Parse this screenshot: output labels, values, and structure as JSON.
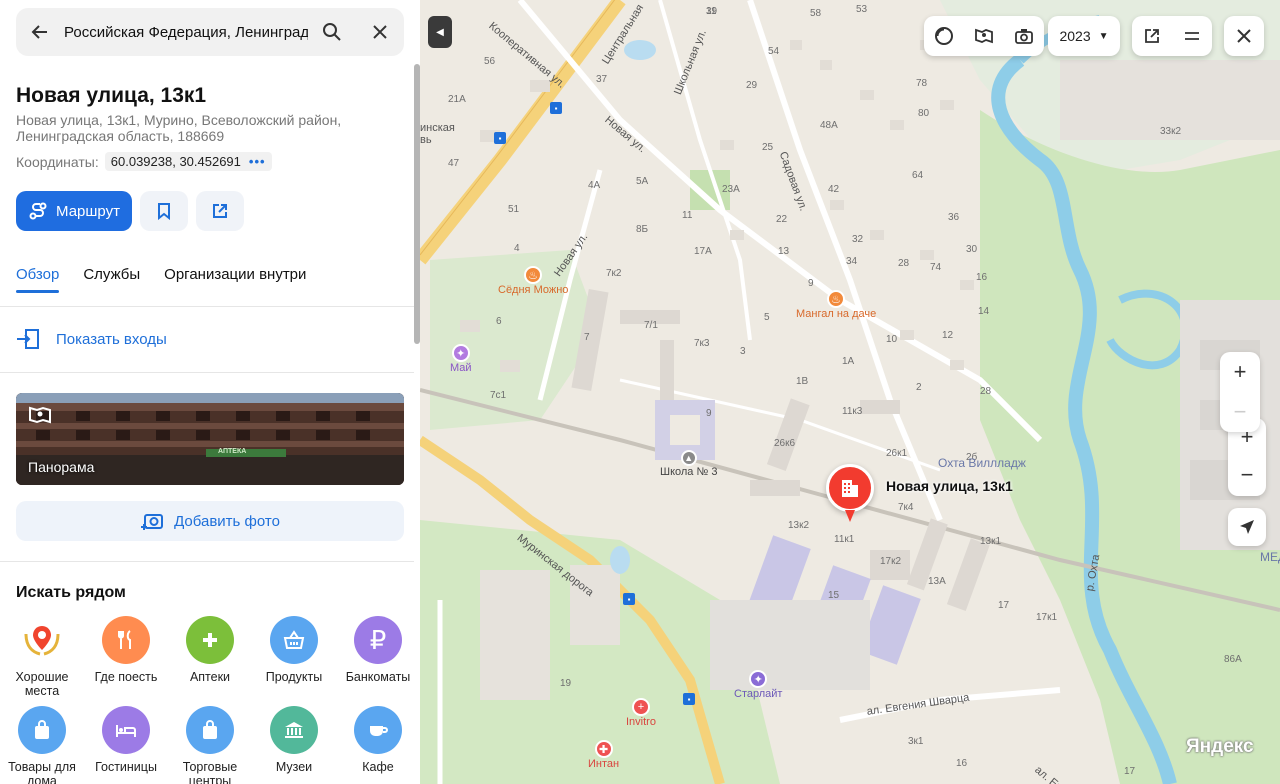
{
  "search": {
    "value": "Российская Федерация, Ленинградс"
  },
  "place": {
    "title": "Новая улица, 13к1",
    "address": "Новая улица, 13к1, Мурино, Всеволожский район, Ленинградская область, 188669",
    "coords_label": "Координаты:",
    "coords_value": "60.039238, 30.452691"
  },
  "actions": {
    "route_label": "Маршрут"
  },
  "tabs": [
    {
      "label": "Обзор"
    },
    {
      "label": "Службы"
    },
    {
      "label": "Организации внутри"
    }
  ],
  "entrances_label": "Показать входы",
  "panorama_label": "Панорама",
  "panorama_sign": "АПТЕКА",
  "add_photo_label": "Добавить фото",
  "nearby": {
    "title": "Искать рядом",
    "items": [
      {
        "label": "Хорошие места",
        "color": "#ffffff",
        "icon": "laurel-pin-icon"
      },
      {
        "label": "Где поесть",
        "color": "#ff8c50",
        "icon": "fork-knife-icon"
      },
      {
        "label": "Аптеки",
        "color": "#7cbf3a",
        "icon": "plus-icon"
      },
      {
        "label": "Продукты",
        "color": "#5aa6f0",
        "icon": "basket-icon"
      },
      {
        "label": "Банкоматы",
        "color": "#9c7be6",
        "icon": "ruble-icon"
      },
      {
        "label": "Товары для дома",
        "color": "#5aa6f0",
        "icon": "shopping-bag-icon"
      },
      {
        "label": "Гостиницы",
        "color": "#9c7be6",
        "icon": "bed-icon"
      },
      {
        "label": "Торговые центры",
        "color": "#5aa6f0",
        "icon": "shopping-bag-icon"
      },
      {
        "label": "Музеи",
        "color": "#52b89a",
        "icon": "museum-icon"
      },
      {
        "label": "Кафе",
        "color": "#5aa6f0",
        "icon": "cup-icon"
      }
    ]
  },
  "map": {
    "year": "2023",
    "marker_label": "Новая улица, 13к1",
    "logo": "Яндекс",
    "streets": {
      "central": "Центральная",
      "cooperative": "Кооперативная ул.",
      "school": "Школьная ул.",
      "novaya1": "Новая ул.",
      "novaya2": "Новая ул.",
      "sadovaya": "Садовая ул.",
      "murinskaya": "Муринская дорога",
      "shvartsa": "ал. Евгения Шварца",
      "okhta": "р. Охта",
      "evgeniya": "ал. Евг"
    },
    "pois": {
      "sedna": "Сёдня Можно",
      "mangal": "Мангал на даче",
      "school": "Школа № 3",
      "okhta_village": "Охта Виллладж",
      "starlight": "Старлайт",
      "invitro": "Invitro",
      "intan": "Интан",
      "mai": "Май",
      "med": "МЕД",
      "rinskaya": "инская",
      "v": "вь"
    },
    "houses": [
      "39",
      "58",
      "53",
      "54",
      "56",
      "37",
      "29",
      "78",
      "21А",
      "80",
      "47",
      "48А",
      "25",
      "33к2",
      "4А",
      "5А",
      "23А",
      "42",
      "64",
      "51",
      "11",
      "22",
      "36",
      "8Б",
      "32",
      "34",
      "30",
      "4",
      "17А",
      "13",
      "28",
      "74",
      "16",
      "7к2",
      "9",
      "14",
      "7/1",
      "5",
      "10",
      "12",
      "6",
      "7",
      "7к3",
      "3",
      "1А",
      "1В",
      "2",
      "28",
      "7с1",
      "9",
      "11к3",
      "26к1",
      "2б",
      "26к6",
      "7к4",
      "13к2",
      "11к1",
      "13к1",
      "17к2",
      "13А",
      "15",
      "17",
      "17к1",
      "19",
      "86А",
      "3к1",
      "16",
      "17",
      "11"
    ]
  }
}
